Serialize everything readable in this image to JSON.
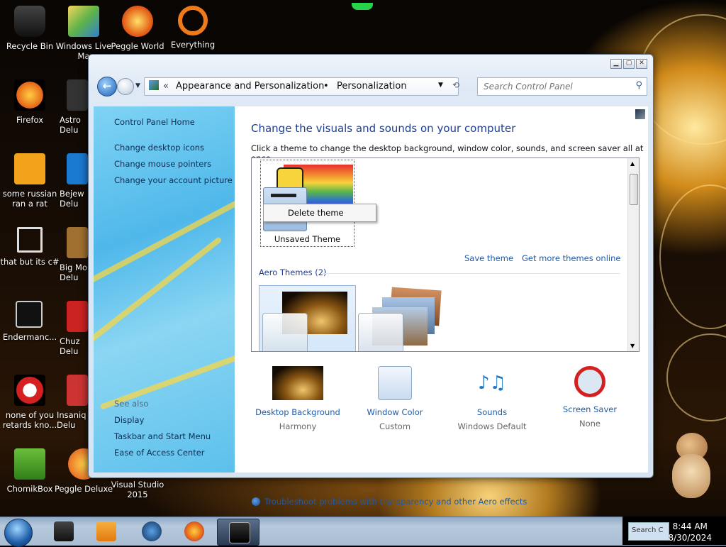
{
  "desktop": {
    "icons": [
      {
        "label": "Recycle Bin"
      },
      {
        "label": "Windows Live Ma"
      },
      {
        "label": "Peggle World"
      },
      {
        "label": "Everything"
      },
      {
        "label": "Firefox"
      },
      {
        "label": "Astro Delu"
      },
      {
        "label": "some russian ran a rat"
      },
      {
        "label": "Bejew Delu"
      },
      {
        "label": "that but its c#"
      },
      {
        "label": "Big Mo Delu"
      },
      {
        "label": "Endermanc..."
      },
      {
        "label": "Chuz Delu"
      },
      {
        "label": "none of you retards kno..."
      },
      {
        "label": "Insaniq Delu"
      },
      {
        "label": "ChomikBox"
      },
      {
        "label": "Peggle Deluxe"
      },
      {
        "label": "Visual Studio 2015"
      }
    ]
  },
  "window": {
    "breadcrumb": {
      "sep_chevrons": "«",
      "crumb1": "Appearance and Personalization",
      "crumb_sep": "•",
      "crumb2": "Personalization"
    },
    "search": {
      "placeholder": "Search Control Panel"
    },
    "sidebar": {
      "links": [
        "Control Panel Home",
        "Change desktop icons",
        "Change mouse pointers",
        "Change your account picture"
      ],
      "see_also_label": "See also",
      "see_also": [
        "Display",
        "Taskbar and Start Menu",
        "Ease of Access Center"
      ]
    },
    "main": {
      "title": "Change the visuals and sounds on your computer",
      "subtitle": "Click a theme to change the desktop background, window color, sounds, and screen saver all at once.",
      "unsaved_theme_label": "Unsaved Theme",
      "context_menu": {
        "delete": "Delete theme"
      },
      "save_theme": "Save theme",
      "get_more": "Get more themes online",
      "aero_group": "Aero Themes (2)",
      "options": [
        {
          "title": "Desktop Background",
          "sub": "Harmony"
        },
        {
          "title": "Window Color",
          "sub": "Custom"
        },
        {
          "title": "Sounds",
          "sub": "Windows Default"
        },
        {
          "title": "Screen Saver",
          "sub": "None"
        }
      ],
      "troubleshoot": "Troubleshoot problems with transparency and other Aero effects"
    }
  },
  "taskbar": {
    "tray_search": "Search C",
    "time": "8:44 AM",
    "date": "8/30/2024"
  }
}
